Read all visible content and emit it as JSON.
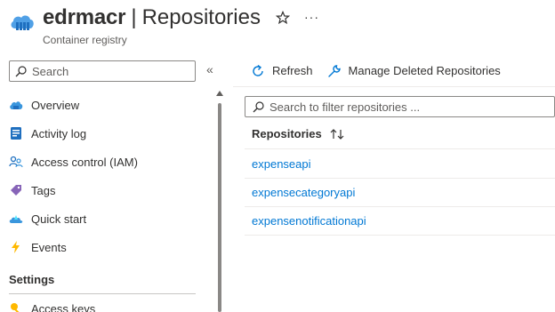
{
  "header": {
    "registry_name": "edrmacr",
    "separator": "|",
    "page_name": "Repositories",
    "subtitle": "Container registry"
  },
  "sidebar": {
    "search_placeholder": "Search",
    "collapse_glyph": "«",
    "items": [
      {
        "label": "Overview",
        "icon": "cloud-icon"
      },
      {
        "label": "Activity log",
        "icon": "activity-log-icon"
      },
      {
        "label": "Access control (IAM)",
        "icon": "people-icon"
      },
      {
        "label": "Tags",
        "icon": "tag-icon"
      },
      {
        "label": "Quick start",
        "icon": "rocket-cloud-icon"
      },
      {
        "label": "Events",
        "icon": "lightning-icon"
      }
    ],
    "section_title": "Settings",
    "partial_item": {
      "label": "Access keys",
      "icon": "key-icon"
    }
  },
  "toolbar": {
    "refresh_label": "Refresh",
    "manage_deleted_label": "Manage Deleted Repositories"
  },
  "filter": {
    "placeholder": "Search to filter repositories ..."
  },
  "table": {
    "column_header": "Repositories",
    "rows": [
      "expenseapi",
      "expensecategoryapi",
      "expensenotificationapi"
    ]
  },
  "colors": {
    "accent": "#0078d4",
    "text": "#323130",
    "muted": "#605e5c"
  }
}
